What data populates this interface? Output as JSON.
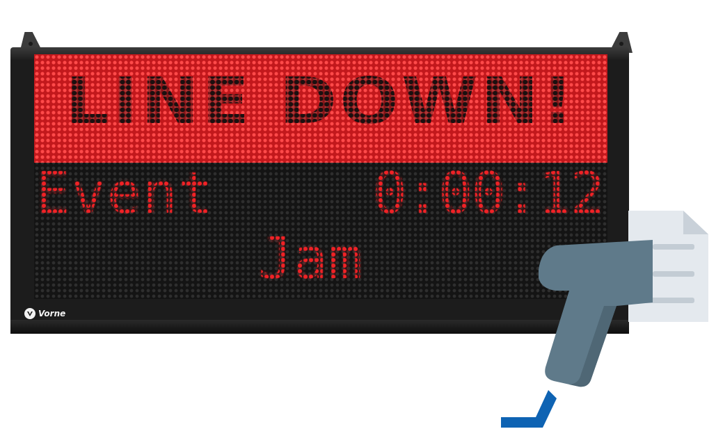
{
  "sign": {
    "banner": "LINE DOWN!",
    "label": "Event",
    "timer": "0:00:12",
    "reason": "Jam",
    "brand": "Vorne"
  },
  "icons": {
    "document": "document-icon",
    "scanner": "barcode-scanner-icon",
    "cable": "scanner-cable-icon",
    "brand_logo": "vorne-logo-icon"
  },
  "colors": {
    "led_red": "#f02226",
    "banner_red": "#e0262a",
    "frame": "#1c1c1c",
    "scanner_body": "#5f7a8a",
    "cable_blue": "#0e63b3",
    "document": "#e4e9ee"
  }
}
